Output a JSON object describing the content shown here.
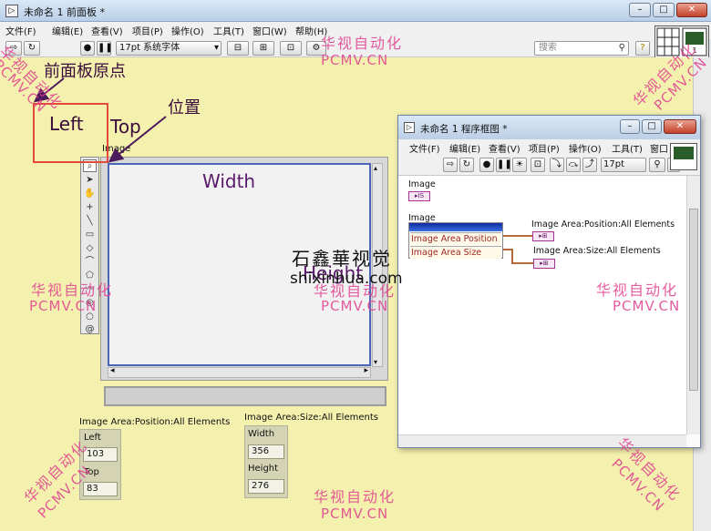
{
  "front_panel": {
    "title": "未命名 1 前面板 *",
    "menu": [
      "文件(F)",
      "编辑(E)",
      "查看(V)",
      "项目(P)",
      "操作(O)",
      "工具(T)",
      "窗口(W)",
      "帮助(H)"
    ],
    "font_select": "17pt 系统字体",
    "search_placeholder": "搜索",
    "image_label": "Image",
    "position_indicator": {
      "title": "Image Area:Position:All Elements",
      "left_label": "Left",
      "left_value": "103",
      "top_label": "Top",
      "top_value": "83"
    },
    "size_indicator": {
      "title": "Image Area:Size:All Elements",
      "width_label": "Width",
      "width_value": "356",
      "height_label": "Height",
      "height_value": "276"
    }
  },
  "block_diagram": {
    "title": "未命名 1 程序框图 *",
    "menu": [
      "文件(F)",
      "编辑(E)",
      "查看(V)",
      "项目(P)",
      "操作(O)",
      "工具(T)",
      "窗口"
    ],
    "font_select": "17pt",
    "image_terminal_label": "Image",
    "property_node_label": "Image",
    "property_1": "Image Area Position",
    "property_2": "Image Area Size",
    "out_1_label": "Image Area:Position:All Elements",
    "out_2_label": "Image Area:Size:All Elements"
  },
  "annotations": {
    "origin": "前面板原点",
    "position": "位置",
    "left": "Left",
    "top": "Top",
    "width": "Width",
    "height": "Height"
  },
  "watermarks": {
    "cn": "华视自动化",
    "en": "PCMV.CN",
    "site": "shixinhua.com",
    "logo": "石鑫華视觉"
  },
  "colors": {
    "panel_bg": "#f4f1ae",
    "annotation_box": "#e24a3a",
    "image_border": "#4b66b8",
    "watermark": "#e04090",
    "wire": "#b36a3a"
  }
}
